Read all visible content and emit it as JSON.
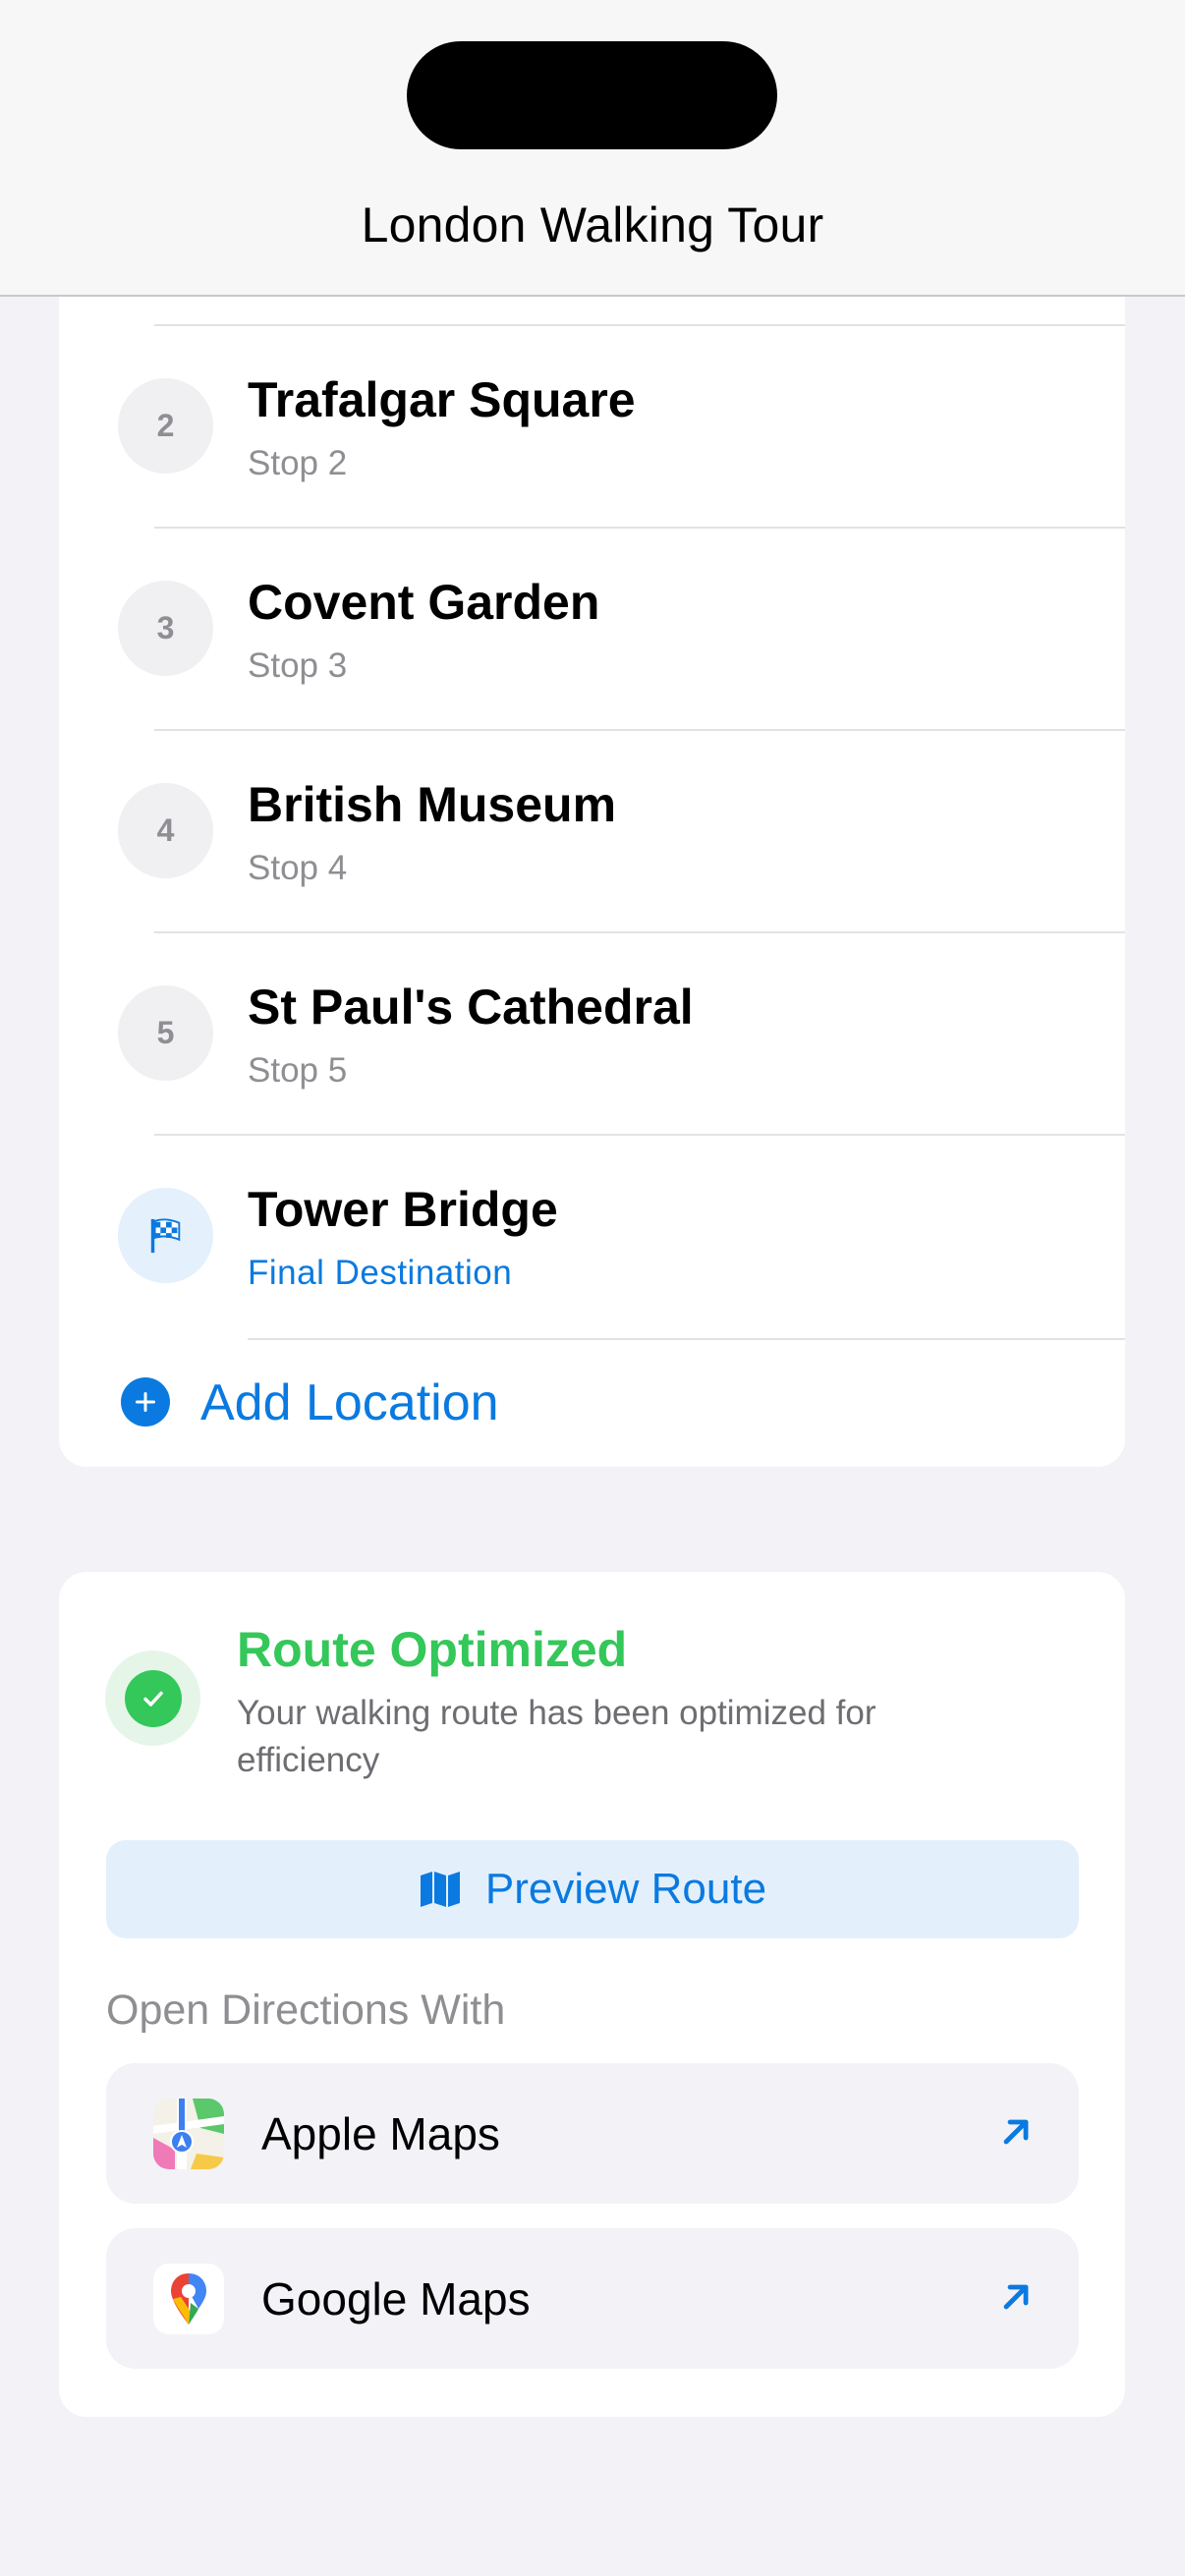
{
  "header": {
    "title": "London Walking Tour"
  },
  "stops": [
    {
      "number": "2",
      "name": "Trafalgar Square",
      "subtitle": "Stop 2"
    },
    {
      "number": "3",
      "name": "Covent Garden",
      "subtitle": "Stop 3"
    },
    {
      "number": "4",
      "name": "British Museum",
      "subtitle": "Stop 4"
    },
    {
      "number": "5",
      "name": "St Paul's Cathedral",
      "subtitle": "Stop 5"
    }
  ],
  "final_stop": {
    "icon": "checkered-flag-icon",
    "name": "Tower Bridge",
    "subtitle": "Final Destination"
  },
  "add_location": {
    "label": "Add Location",
    "icon": "plus-circle-icon"
  },
  "route": {
    "title": "Route Optimized",
    "description": "Your walking route has been optimized for efficiency",
    "preview_label": "Preview Route",
    "preview_icon": "map-icon",
    "directions_label": "Open Directions With",
    "apps": [
      {
        "label": "Apple Maps",
        "icon": "apple-maps-icon"
      },
      {
        "label": "Google Maps",
        "icon": "google-maps-icon"
      }
    ]
  },
  "colors": {
    "accent": "#0a7ae0",
    "success": "#34c759",
    "background": "#f2f2f7"
  }
}
